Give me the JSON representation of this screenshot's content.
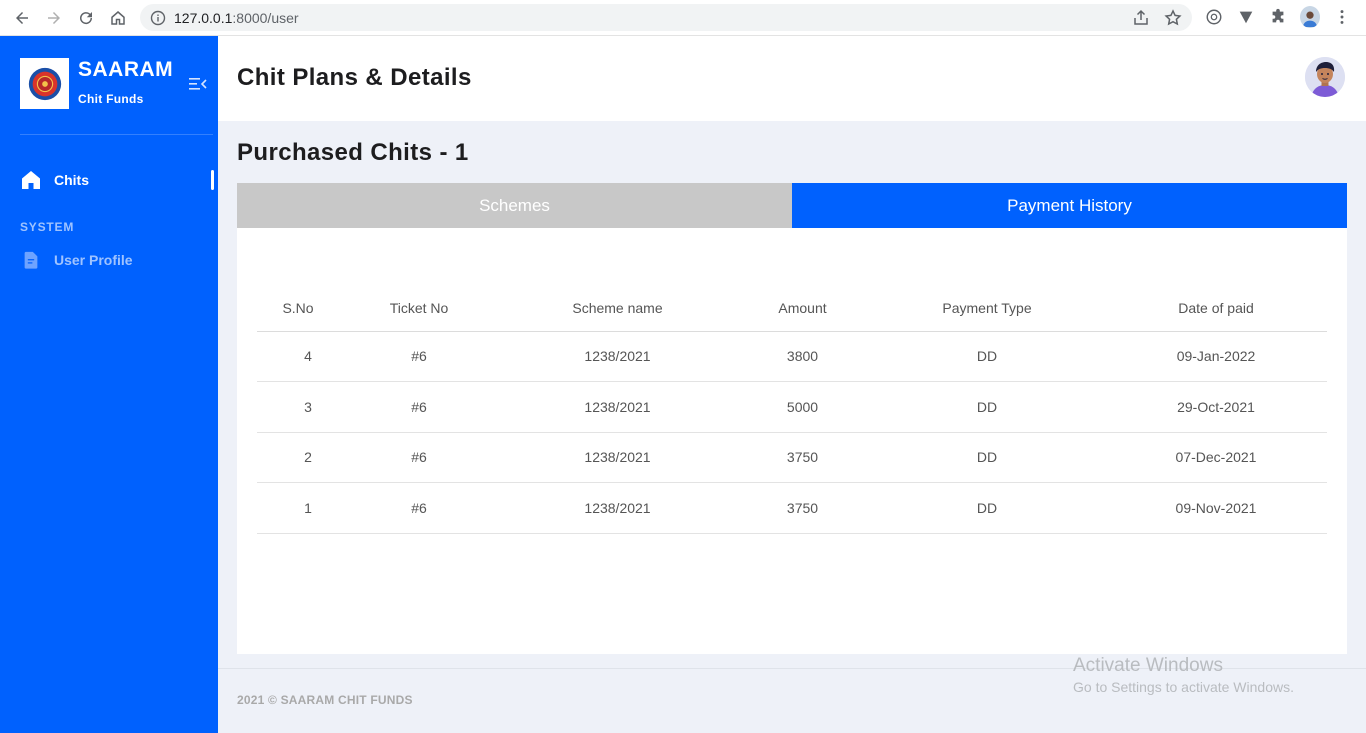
{
  "browser": {
    "url_host": "127.0.0.1",
    "url_path": ":8000/user"
  },
  "sidebar": {
    "brand_name": "SAARAM",
    "brand_sub": "Chit Funds",
    "items": [
      {
        "label": "Chits",
        "icon": "home-icon"
      },
      {
        "label": "User Profile",
        "icon": "document-icon"
      }
    ],
    "section_label": "SYSTEM",
    "accent_color": "#0061fe"
  },
  "header": {
    "title": "Chit Plans & Details"
  },
  "main": {
    "section_title": "Purchased Chits - 1",
    "tabs": [
      {
        "label": "Schemes",
        "active": false
      },
      {
        "label": "Payment History",
        "active": true
      }
    ],
    "table": {
      "columns": [
        "S.No",
        "Ticket No",
        "Scheme name",
        "Amount",
        "Payment Type",
        "Date of paid"
      ],
      "rows": [
        [
          "4",
          "#6",
          "1238/2021",
          "3800",
          "DD",
          "09-Jan-2022"
        ],
        [
          "3",
          "#6",
          "1238/2021",
          "5000",
          "DD",
          "29-Oct-2021"
        ],
        [
          "2",
          "#6",
          "1238/2021",
          "3750",
          "DD",
          "07-Dec-2021"
        ],
        [
          "1",
          "#6",
          "1238/2021",
          "3750",
          "DD",
          "09-Nov-2021"
        ]
      ]
    }
  },
  "footer": {
    "text": "2021 © SAARAM CHIT FUNDS"
  },
  "watermark": {
    "line1": "Activate Windows",
    "line2": "Go to Settings to activate Windows."
  }
}
